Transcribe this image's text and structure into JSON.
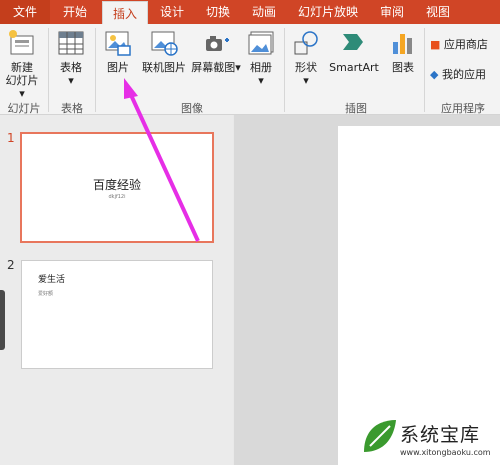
{
  "tabs": [
    "文件",
    "开始",
    "插入",
    "设计",
    "切换",
    "动画",
    "幻灯片放映",
    "审阅",
    "视图"
  ],
  "ribbon": {
    "new_slide": [
      "新建",
      "幻灯片"
    ],
    "table": "表格",
    "picture": "图片",
    "online_picture": "联机图片",
    "screenshot": "屏幕截图",
    "album": "相册",
    "shapes": "形状",
    "smartart": "SmartArt",
    "chart": "图表",
    "store": "应用商店",
    "my_apps": "我的应用"
  },
  "groups": [
    "幻灯片",
    "表格",
    "图像",
    "插图",
    "应用程序"
  ],
  "slides": [
    {
      "number": "1",
      "title": "百度经验",
      "subtitle": "dkjf12i"
    },
    {
      "number": "2",
      "title": "爱生活",
      "subtitle": "爱好额"
    }
  ],
  "watermark": {
    "name": "系统宝库",
    "url": "www.xitongbaoku.com"
  },
  "colors": {
    "accent": "#d04526",
    "arrow": "#e62ee6"
  }
}
